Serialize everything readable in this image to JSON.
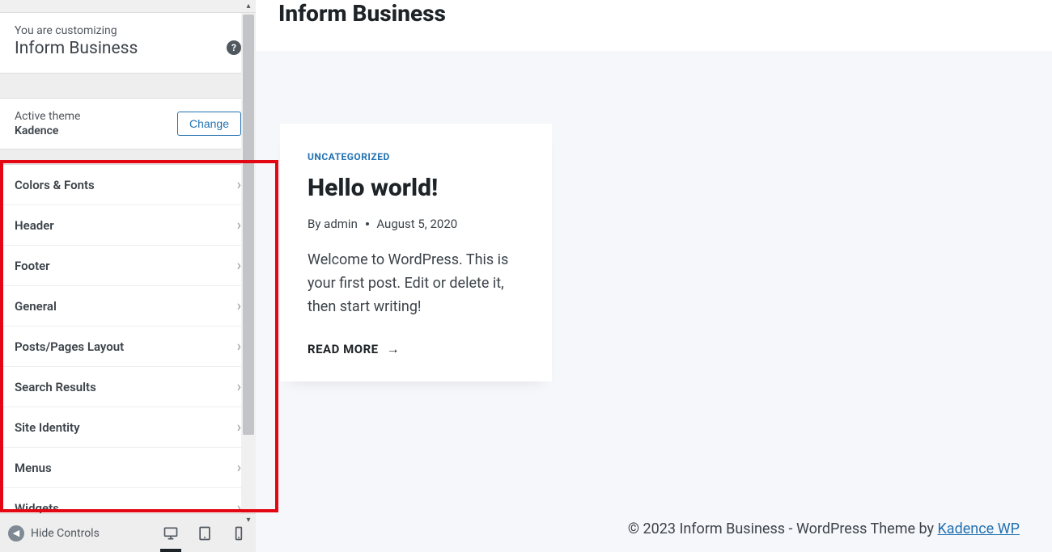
{
  "sidebar": {
    "customizing_label": "You are customizing",
    "customizing_title": "Inform Business",
    "active_theme_label": "Active theme",
    "active_theme_name": "Kadence",
    "change_button": "Change",
    "menu": [
      "Colors & Fonts",
      "Header",
      "Footer",
      "General",
      "Posts/Pages Layout",
      "Search Results",
      "Site Identity",
      "Menus",
      "Widgets"
    ],
    "hide_controls": "Hide Controls"
  },
  "preview": {
    "site_title": "Inform Business",
    "post": {
      "category": "UNCATEGORIZED",
      "title": "Hello world!",
      "meta_by": "By admin",
      "meta_date": "August 5, 2020",
      "excerpt": "Welcome to WordPress. This is your first post. Edit or delete it, then start writing!",
      "read_more": "READ MORE"
    },
    "footer_text": "© 2023 Inform Business - WordPress Theme by ",
    "footer_link": "Kadence WP"
  }
}
